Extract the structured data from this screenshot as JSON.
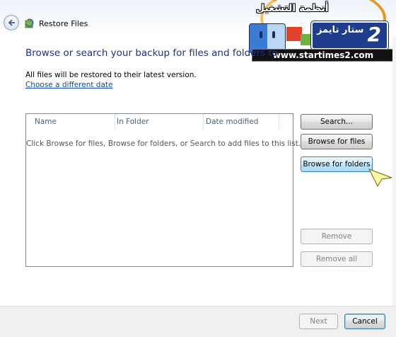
{
  "window": {
    "title": "Restore Files"
  },
  "watermark": {
    "arabic_top": "أنظمة التشغيل",
    "arabic_box": "ستار تايمز",
    "box_logo": "2",
    "url": "www.startimes2.com"
  },
  "main": {
    "heading": "Browse or search your backup for files and folders to",
    "info": "All files will be restored to their latest version.",
    "choose_date_link": "Choose a different date"
  },
  "list": {
    "columns": [
      "Name",
      "In Folder",
      "Date modified"
    ],
    "empty_message": "Click Browse for files, Browse for folders, or Search to add files to this list."
  },
  "side_buttons": {
    "search": "Search...",
    "browse_files": "Browse for files",
    "browse_folders": "Browse for folders",
    "remove": "Remove",
    "remove_all": "Remove all"
  },
  "footer": {
    "next": "Next",
    "cancel": "Cancel"
  },
  "colors": {
    "heading": "#1e3287",
    "link": "#0b4ba5"
  }
}
